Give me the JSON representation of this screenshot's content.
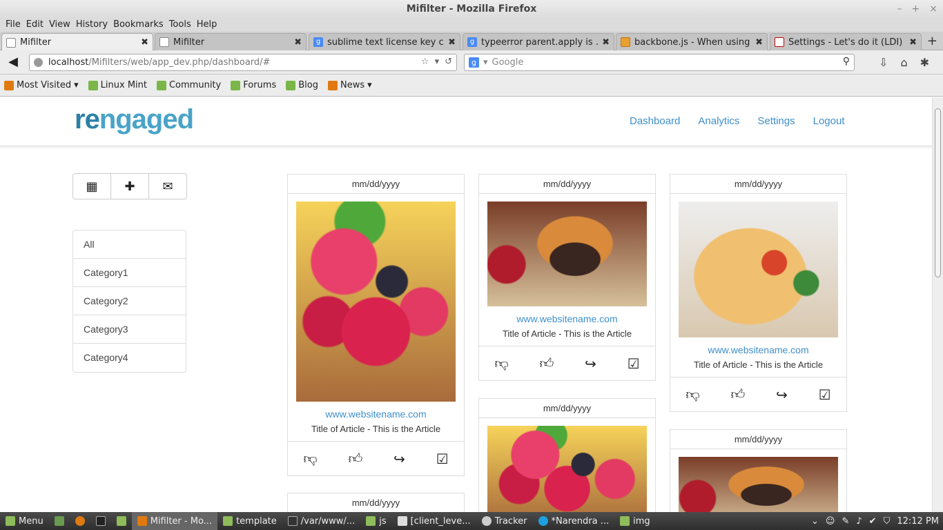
{
  "window": {
    "title": "Mifilter - Mozilla Firefox"
  },
  "menu": [
    "File",
    "Edit",
    "View",
    "History",
    "Bookmarks",
    "Tools",
    "Help"
  ],
  "tabs": [
    {
      "title": "Mifilter"
    },
    {
      "title": "Mifilter"
    },
    {
      "title": "sublime text license key cr..."
    },
    {
      "title": "typeerror parent.apply is ..."
    },
    {
      "title": "backbone.js - When using ..."
    },
    {
      "title": "Settings - Let's do it (LDI) ..."
    }
  ],
  "url": {
    "host": "localhost",
    "path": "/Mifilters/web/app_dev.php/dashboard/#"
  },
  "search": {
    "placeholder": "Google"
  },
  "bookmarks": [
    "Most Visited",
    "Linux Mint",
    "Community",
    "Forums",
    "Blog",
    "News"
  ],
  "app": {
    "logo_a": "re",
    "logo_b": "ngaged",
    "nav": [
      "Dashboard",
      "Analytics",
      "Settings",
      "Logout"
    ],
    "categories": [
      "All",
      "Category1",
      "Category2",
      "Category3",
      "Category4"
    ],
    "cards": [
      {
        "date": "mm/dd/yyyy",
        "site": "www.websitename.com",
        "title": "Title of Article - This is the Article"
      },
      {
        "date": "mm/dd/yyyy",
        "site": "www.websitename.com",
        "title": "Title of Article - This is the Article"
      },
      {
        "date": "mm/dd/yyyy",
        "site": "www.websitename.com",
        "title": "Title of Article - This is the Article"
      },
      {
        "date": "mm/dd/yyyy"
      },
      {
        "date": "mm/dd/yyyy"
      },
      {
        "date": "mm/dd/yyyy"
      }
    ]
  },
  "taskbar": {
    "menu": "Menu",
    "items": [
      "Mifilter - Mo...",
      "template",
      "/var/www/...",
      "js",
      "[client_leve...",
      "Tracker",
      "*Narendra ...",
      "img"
    ],
    "clock": "12:12 PM"
  }
}
